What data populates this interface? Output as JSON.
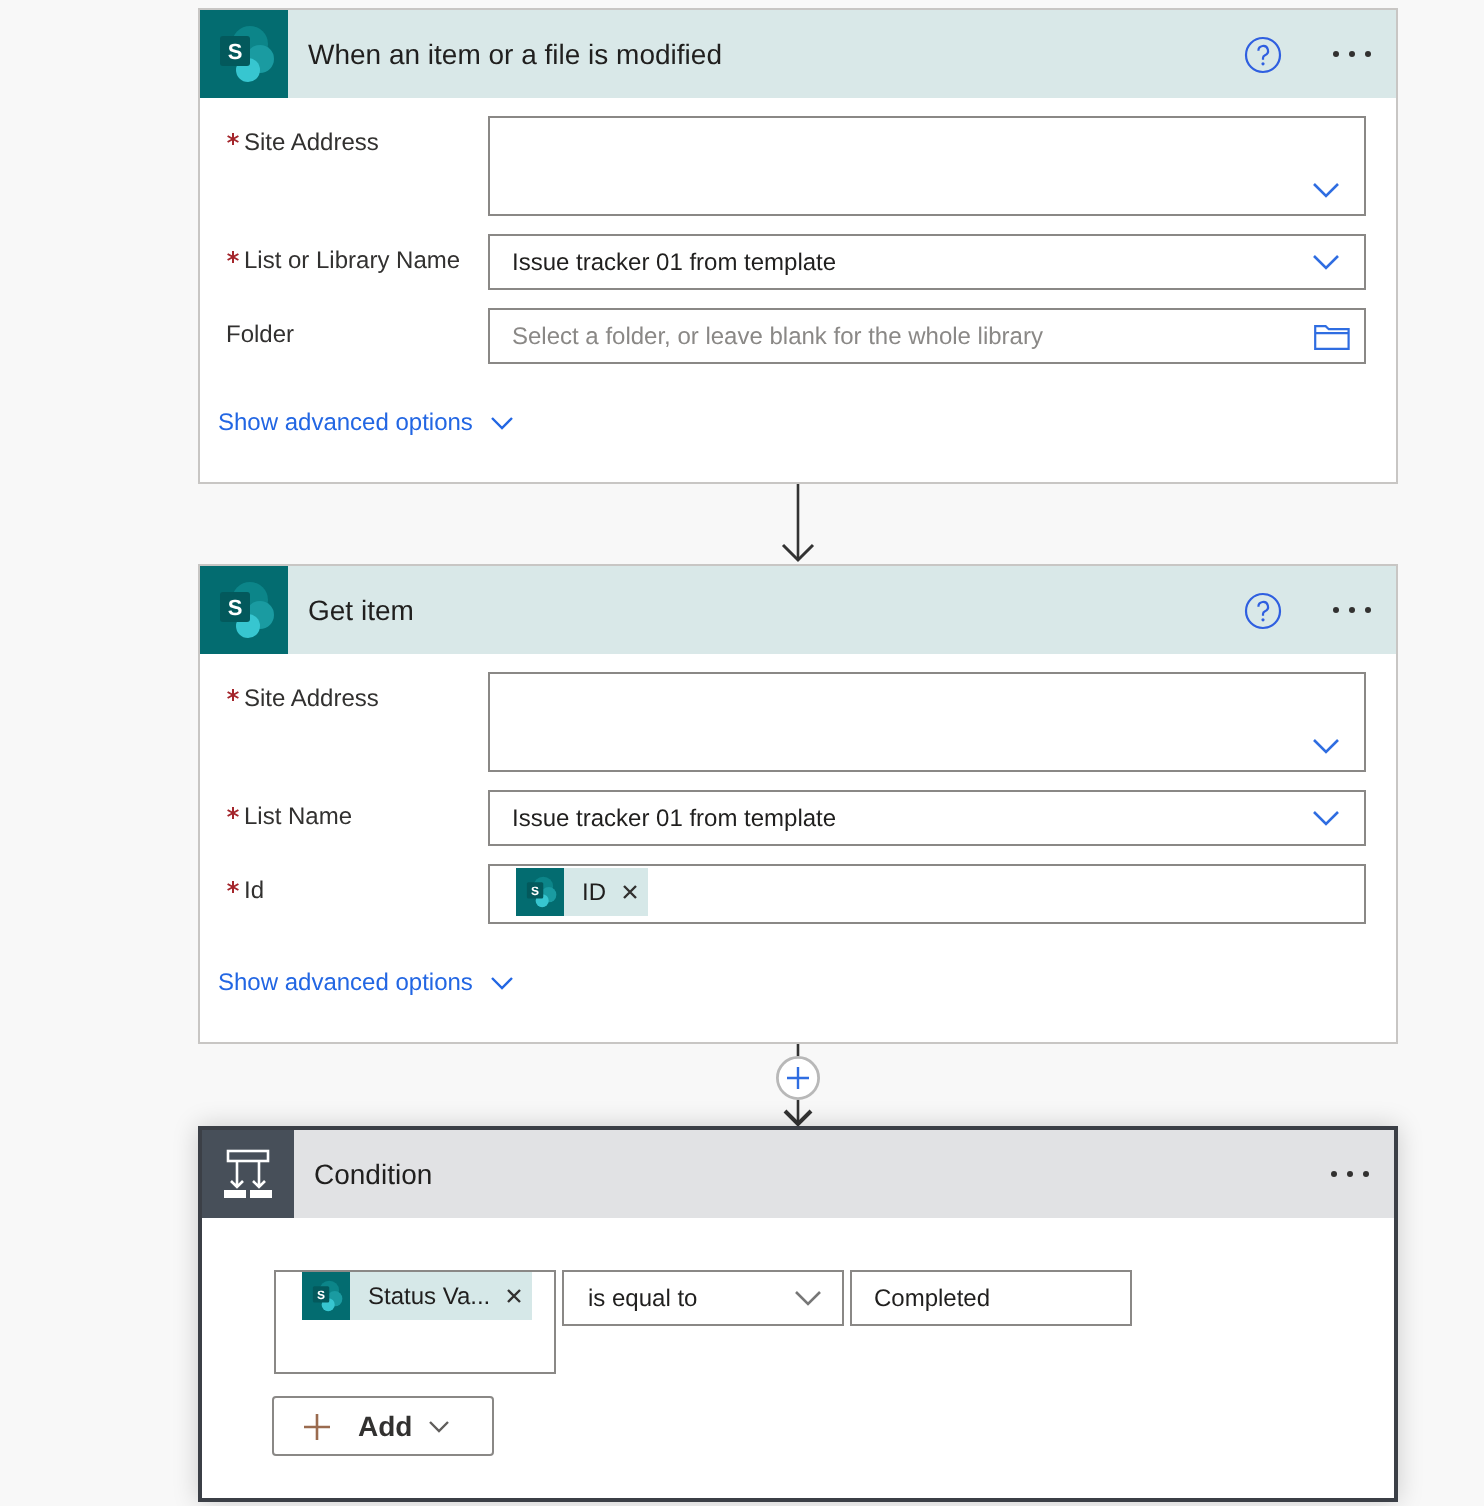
{
  "steps": [
    {
      "kind": "sharepoint",
      "icon_letter": "S",
      "title": "When an item or a file is modified",
      "selected": false,
      "help": true,
      "fields": [
        {
          "kind": "combobox",
          "label": "Site Address",
          "required": true
        },
        {
          "kind": "dropdown",
          "label": "List or Library Name",
          "required": true,
          "value": "Issue tracker 01 from template"
        },
        {
          "kind": "picker",
          "label": "Folder",
          "required": false,
          "placeholder": "Select a folder, or leave blank for the whole library"
        }
      ],
      "advanced_link": "Show advanced options"
    },
    {
      "kind": "sharepoint",
      "icon_letter": "S",
      "title": "Get item",
      "selected": false,
      "help": true,
      "fields": [
        {
          "kind": "combobox",
          "label": "Site Address",
          "required": true
        },
        {
          "kind": "dropdown",
          "label": "List Name",
          "required": true,
          "value": "Issue tracker 01 from template"
        },
        {
          "kind": "tokens",
          "label": "Id",
          "required": true,
          "tokens": [
            {
              "icon_letter": "S",
              "label": "ID"
            }
          ]
        }
      ],
      "advanced_link": "Show advanced options"
    },
    {
      "kind": "condition",
      "title": "Condition",
      "selected": true,
      "help": false,
      "rows": [
        {
          "operand": {
            "tokens": [
              {
                "icon_letter": "S",
                "label": "Status Va..."
              }
            ]
          },
          "operator": "is equal to",
          "value": "Completed"
        }
      ],
      "add_button": "Add"
    }
  ],
  "connectors": [
    {
      "add_step": false
    },
    {
      "add_step": true
    }
  ]
}
